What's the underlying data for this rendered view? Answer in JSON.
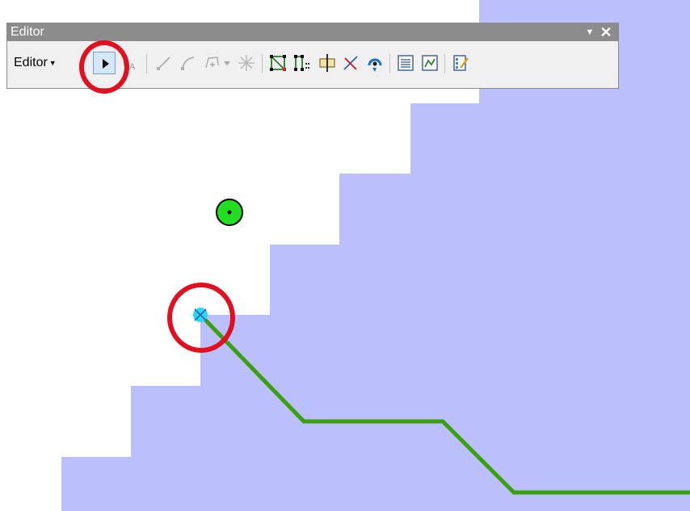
{
  "editor_window": {
    "title": "Editor",
    "dropdown_arrow_icon": "triangle-down-icon",
    "close_icon": "close-icon",
    "editor_menu_label": "Editor",
    "tools": [
      {
        "name": "edit-tool",
        "icon": "arrow-pointer-icon",
        "selected": true
      },
      {
        "name": "edit-annotation-tool",
        "icon": "annotation-icon"
      },
      {
        "name": "straight-segment-tool",
        "icon": "straight-segment-icon"
      },
      {
        "name": "endpoint-arc-tool",
        "icon": "arc-segment-icon"
      },
      {
        "name": "trace-tool",
        "icon": "trace-icon"
      },
      {
        "name": "point-tool",
        "icon": "midpoint-icon"
      },
      {
        "name": "edit-vertices-tool",
        "icon": "edit-vertices-icon"
      },
      {
        "name": "reshape-feature-tool",
        "icon": "reshape-icon"
      },
      {
        "name": "cut-polygons-tool",
        "icon": "cut-polygon-icon"
      },
      {
        "name": "split-tool",
        "icon": "split-icon"
      },
      {
        "name": "rotate-tool",
        "icon": "rotate-icon"
      },
      {
        "name": "attributes-button",
        "icon": "attributes-table-icon"
      },
      {
        "name": "sketch-properties-button",
        "icon": "sketch-properties-icon"
      },
      {
        "name": "create-features-button",
        "icon": "create-features-icon"
      }
    ]
  },
  "map": {
    "polygon_fill": "#bbbffb",
    "background": "#ffffff",
    "line_color": "#3aa010",
    "point_color": "#22dd22",
    "selected_vertex_color": "#22ddee",
    "highlight_color": "#e01020"
  }
}
